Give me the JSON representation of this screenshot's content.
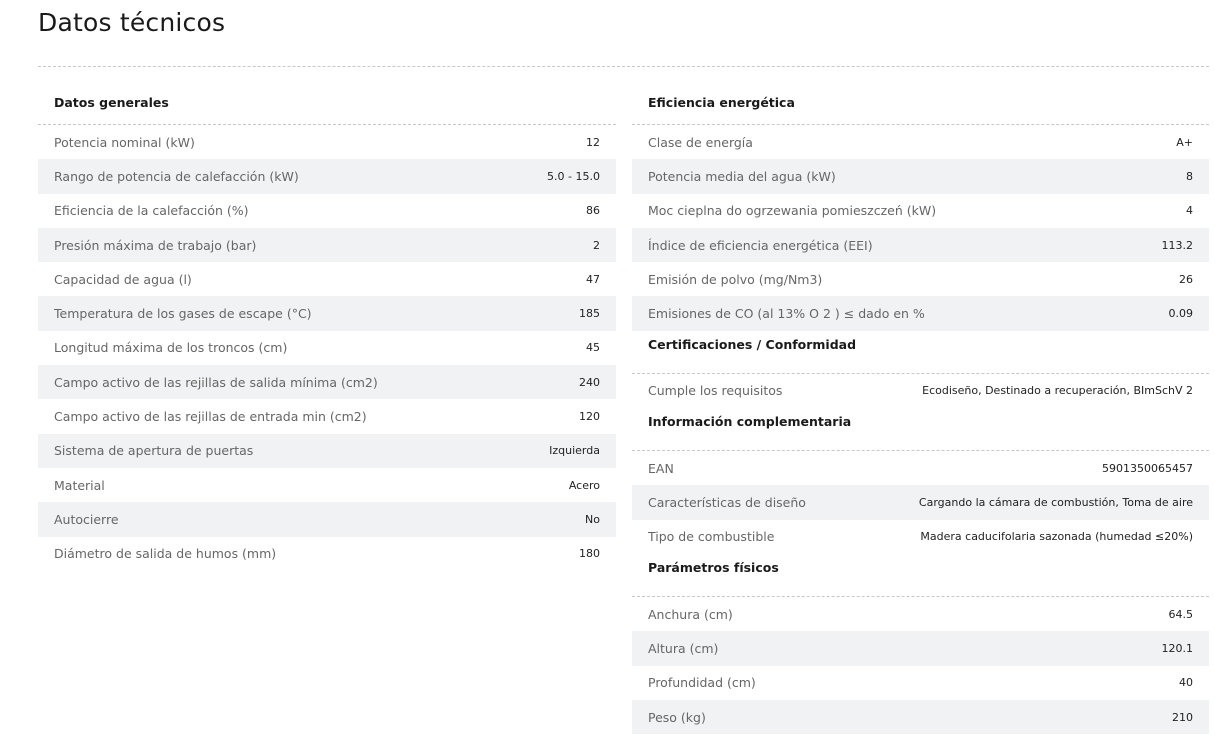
{
  "page_title": "Datos técnicos",
  "left_sections": [
    {
      "title": "Datos generales",
      "rows": [
        {
          "label": "Potencia nominal (kW)",
          "value": "12"
        },
        {
          "label": "Rango de potencia de calefacción (kW)",
          "value": "5.0 - 15.0"
        },
        {
          "label": "Eficiencia de la calefacción (%)",
          "value": "86"
        },
        {
          "label": "Presión máxima de trabajo (bar)",
          "value": "2"
        },
        {
          "label": "Capacidad de agua (l)",
          "value": "47"
        },
        {
          "label": "Temperatura de los gases de escape (°C)",
          "value": "185"
        },
        {
          "label": "Longitud máxima de los troncos (cm)",
          "value": "45"
        },
        {
          "label": "Campo activo de las rejillas de salida mínima (cm2)",
          "value": "240"
        },
        {
          "label": "Campo activo de las rejillas de entrada min (cm2)",
          "value": "120"
        },
        {
          "label": "Sistema de apertura de puertas",
          "value": "Izquierda"
        },
        {
          "label": "Material",
          "value": "Acero"
        },
        {
          "label": "Autocierre",
          "value": "No"
        },
        {
          "label": "Diámetro de salida de humos (mm)",
          "value": "180"
        }
      ]
    }
  ],
  "right_sections": [
    {
      "title": "Eficiencia energética",
      "rows": [
        {
          "label": "Clase de energía",
          "value": "A+"
        },
        {
          "label": "Potencia media del agua (kW)",
          "value": "8"
        },
        {
          "label": "Moc cieplna do ogrzewania pomieszczeń (kW)",
          "value": "4"
        },
        {
          "label": "Índice de eficiencia energética (EEI)",
          "value": "113.2"
        },
        {
          "label": "Emisión de polvo (mg/Nm3)",
          "value": "26"
        },
        {
          "label": "Emisiones de CO (al 13% O 2 ) ≤ dado en %",
          "value": "0.09"
        }
      ]
    },
    {
      "title": "Certificaciones / Conformidad",
      "rows": [
        {
          "label": "Cumple los requisitos",
          "value": "Ecodiseño, Destinado a recuperación, BImSchV 2"
        }
      ]
    },
    {
      "title": "Información complementaria",
      "rows": [
        {
          "label": "EAN",
          "value": "5901350065457"
        },
        {
          "label": "Características de diseño",
          "value": "Cargando la cámara de combustión, Toma de aire"
        },
        {
          "label": "Tipo de combustible",
          "value": "Madera caducifolaria sazonada (humedad ≤20%)"
        }
      ]
    },
    {
      "title": "Parámetros físicos",
      "rows": [
        {
          "label": "Anchura (cm)",
          "value": "64.5"
        },
        {
          "label": "Altura (cm)",
          "value": "120.1"
        },
        {
          "label": "Profundidad (cm)",
          "value": "40"
        },
        {
          "label": "Peso (kg)",
          "value": "210"
        }
      ]
    }
  ]
}
